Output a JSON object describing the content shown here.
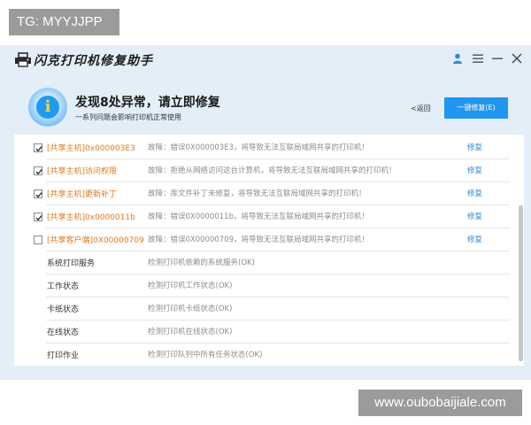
{
  "watermark_top": "TG: MYYJJPP",
  "watermark_bottom": "www.oubobaijiale.com",
  "app": {
    "title": "闪克打印机修复助手",
    "icons": {
      "logo": "printer-icon",
      "user": "user-icon",
      "menu": "menu-icon",
      "minimize": "minimize-icon",
      "close": "close-icon"
    }
  },
  "header": {
    "icon": "info-icon",
    "icon_glyph": "i",
    "title": "发现8处异常，请立即修复",
    "subtitle": "一系列问题会影响打印机正常使用",
    "back_label": "<返回",
    "fix_all_label": "一键修复(E)"
  },
  "items": [
    {
      "checked": true,
      "name": "[共享主机]0x000003E3",
      "desc": "故障：错误0X000003E3，将导致无法互联局域网共享的打印机！",
      "action": "修复"
    },
    {
      "checked": true,
      "name": "[共享主机]访问权限",
      "desc": "故障：拒绝从网络访问这台计算机，将导致无法互联局域网共享的打印机！",
      "action": "修复"
    },
    {
      "checked": true,
      "name": "[共享主机]更新补丁",
      "desc": "故障：库文件补丁未修复，将导致无法互联局域网共享的打印机！",
      "action": "修复"
    },
    {
      "checked": true,
      "name": "[共享主机]0x0000011b",
      "desc": "故障：错误0X0000011b，将导致无法互联局域网共享的打印机！",
      "action": "修复"
    },
    {
      "checked": false,
      "name": "[共享客户端]0X00000709",
      "desc": "故障：错误0X00000709，将导致无法互联局域网共享的打印机！",
      "action": "修复"
    }
  ],
  "checks": [
    {
      "name": "系统打印服务",
      "desc": "检测打印机依赖的系统服务(OK)"
    },
    {
      "name": "工作状态",
      "desc": "检测打印机工作状态(OK)"
    },
    {
      "name": "卡纸状态",
      "desc": "检测打印机卡纸状态(OK)"
    },
    {
      "name": "在线状态",
      "desc": "检测打印机在线状态(OK)"
    },
    {
      "name": "打印作业",
      "desc": "检测打印队列中所有任务状态(OK)"
    }
  ],
  "colors": {
    "accent": "#2196f0",
    "warning_text": "#e07a1f",
    "link": "#2f8ad8",
    "background": "#e3eef9"
  }
}
